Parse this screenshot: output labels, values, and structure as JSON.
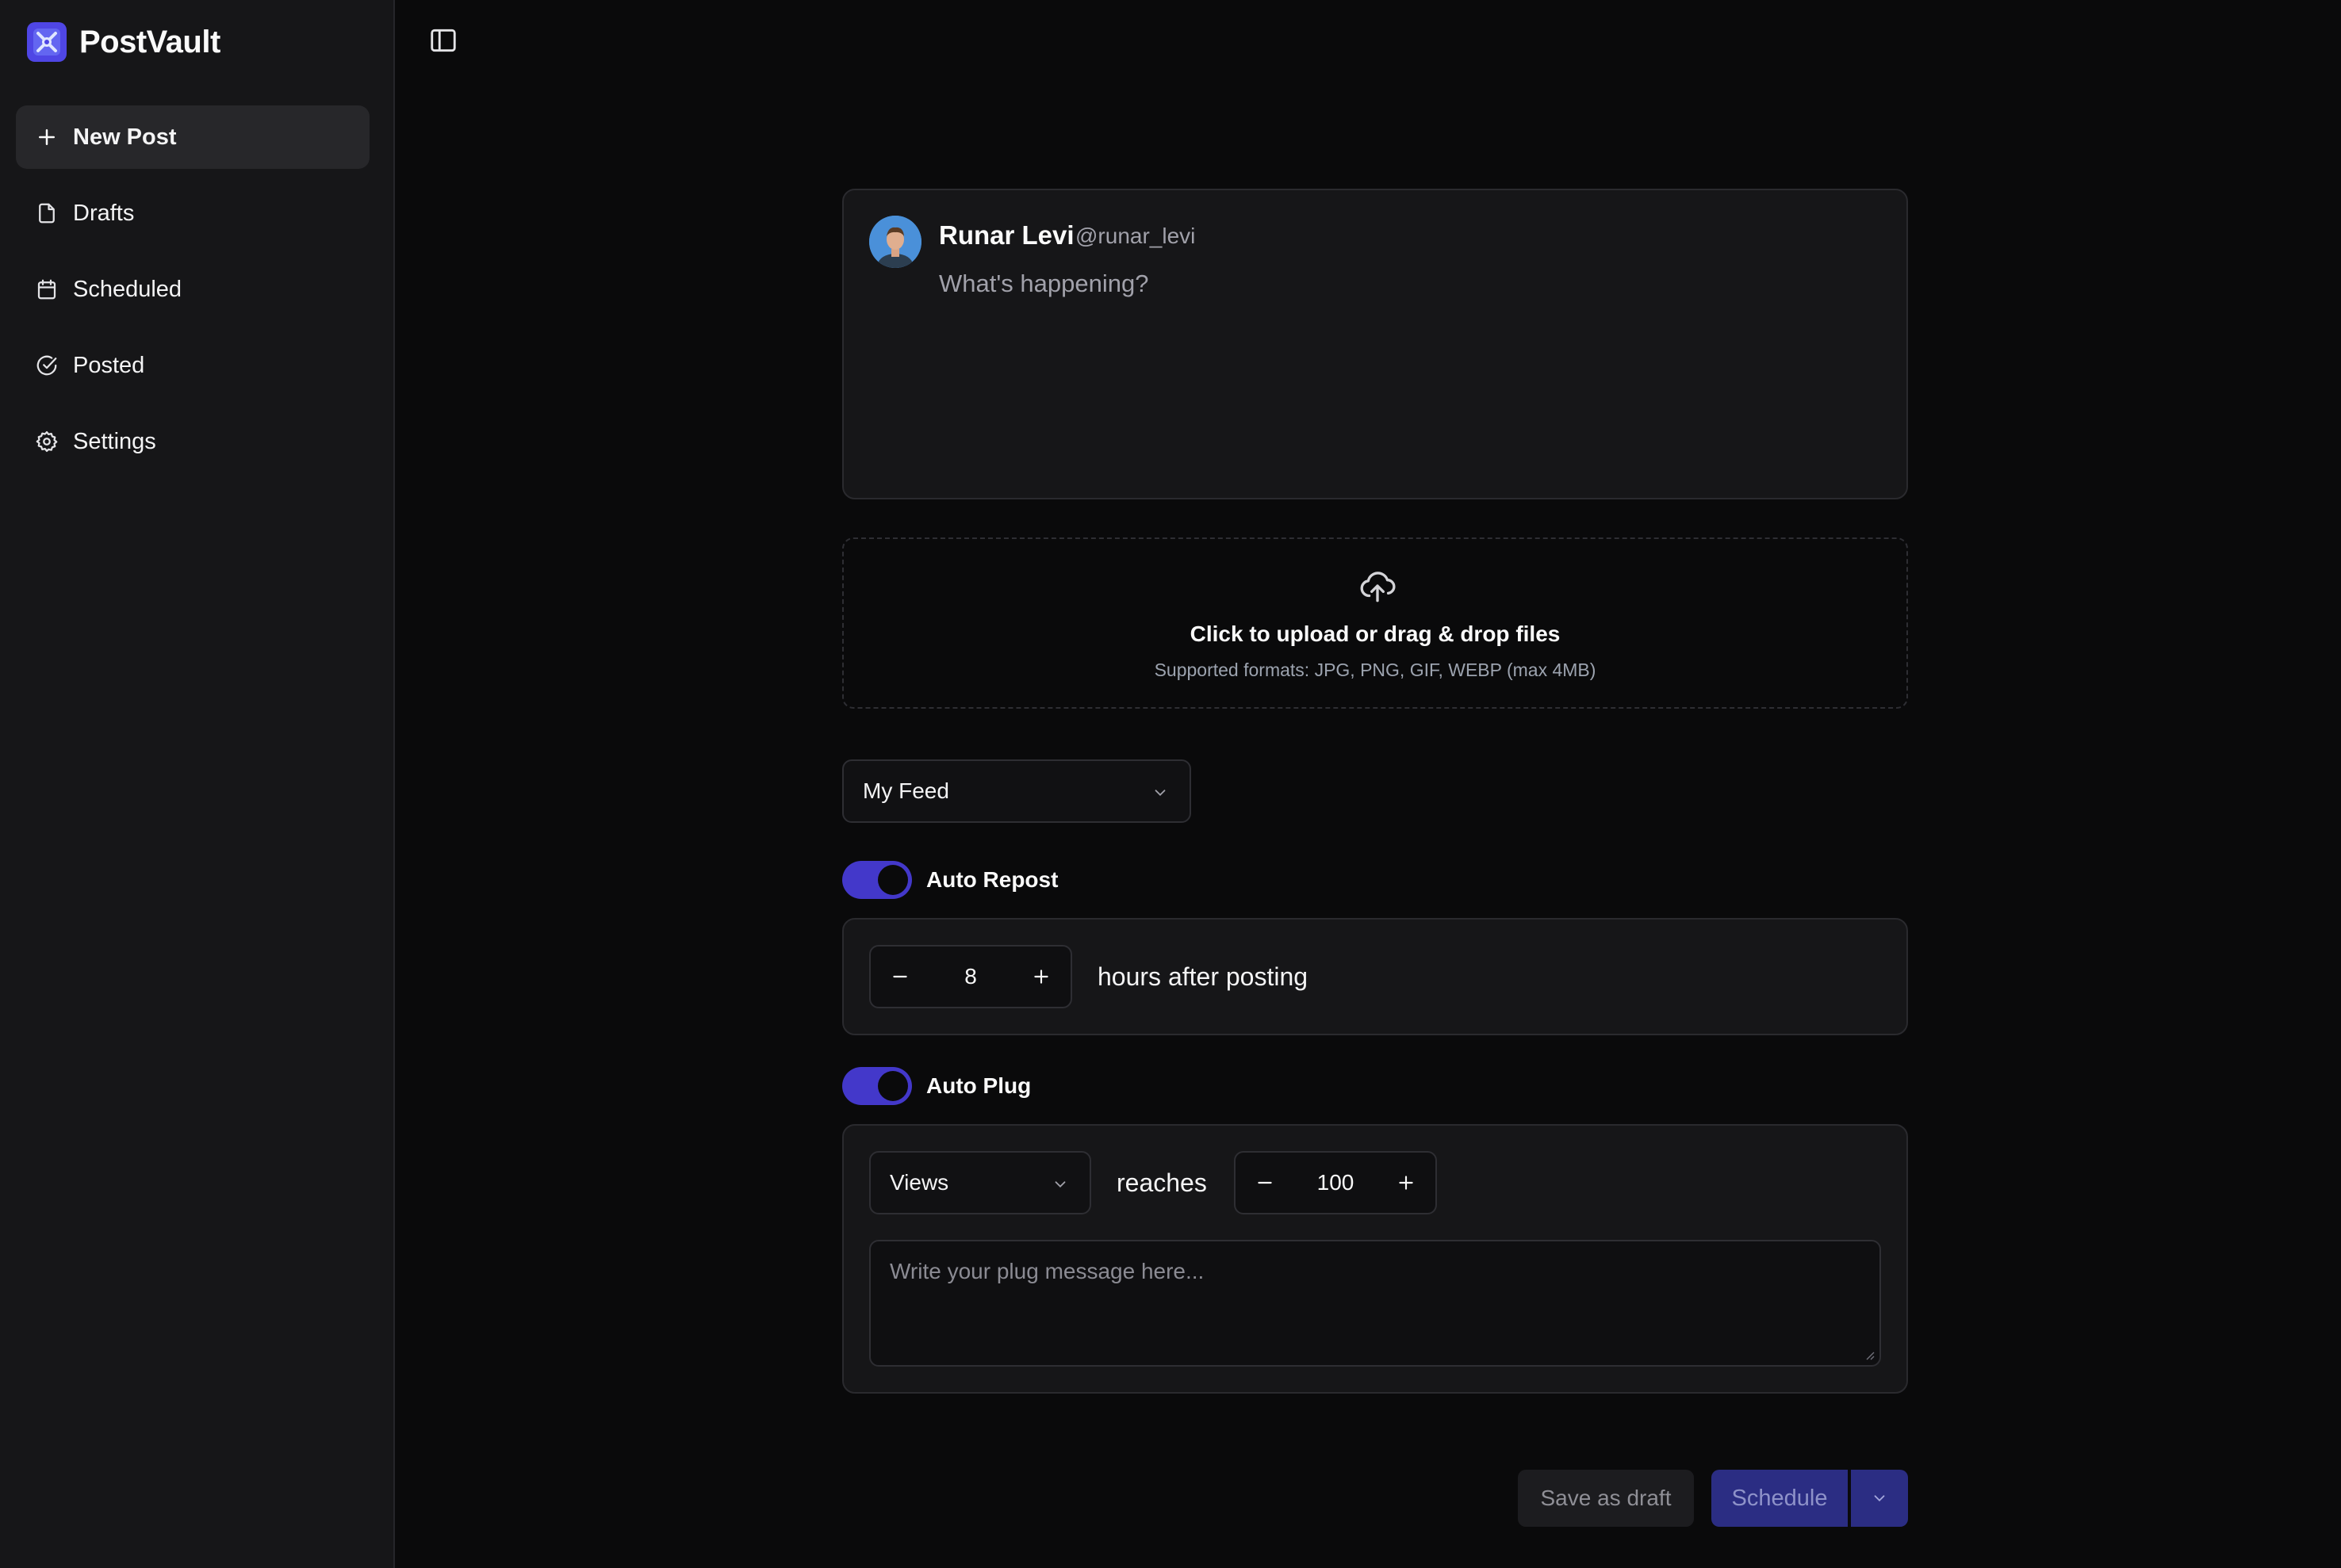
{
  "app": {
    "name": "PostVault",
    "accent_color": "#4338ca",
    "logo_icon": "app-logo-icon"
  },
  "sidebar": {
    "items": [
      {
        "label": "New Post",
        "icon": "plus-icon",
        "active": true
      },
      {
        "label": "Drafts",
        "icon": "file-icon",
        "active": false
      },
      {
        "label": "Scheduled",
        "icon": "calendar-icon",
        "active": false
      },
      {
        "label": "Posted",
        "icon": "check-circle-icon",
        "active": false
      },
      {
        "label": "Settings",
        "icon": "gear-icon",
        "active": false
      }
    ],
    "toggle_icon": "sidebar-toggle-icon"
  },
  "composer": {
    "author_name": "Runar Levi",
    "author_handle": "@runar_levi",
    "placeholder": "What's happening?"
  },
  "upload": {
    "title": "Click to upload or drag & drop files",
    "subtitle": "Supported formats: JPG, PNG, GIF, WEBP (max 4MB)",
    "icon": "cloud-upload-icon"
  },
  "feed_select": {
    "selected": "My Feed"
  },
  "auto_repost": {
    "label": "Auto Repost",
    "enabled": true,
    "value": "8",
    "suffix": "hours after posting"
  },
  "auto_plug": {
    "label": "Auto Plug",
    "enabled": true,
    "metric": "Views",
    "connector": "reaches",
    "value": "100",
    "message_placeholder": "Write your plug message here..."
  },
  "actions": {
    "save_draft": "Save as draft",
    "schedule": "Schedule"
  }
}
